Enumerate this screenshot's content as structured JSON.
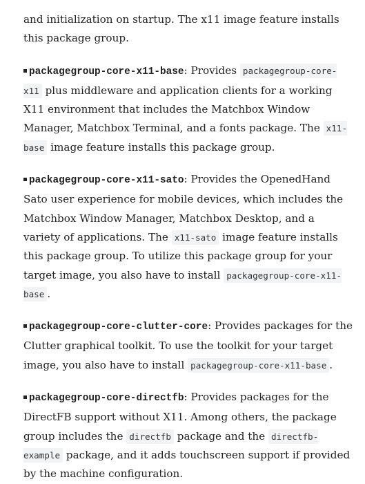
{
  "paragraphs": [
    {
      "segments": [
        {
          "kind": "text",
          "text": "and initialization on startup. The x11 image feature installs this package group."
        }
      ]
    },
    {
      "segments": [
        {
          "kind": "term",
          "text": "packagegroup-core-x11-base"
        },
        {
          "kind": "text",
          "text": ": Provides "
        },
        {
          "kind": "code",
          "text": "packagegroup-core-x11"
        },
        {
          "kind": "text",
          "text": " plus middleware and application clients for a working X11 environment that includes the Matchbox Window Manager, Matchbox Terminal, and a fonts package. The "
        },
        {
          "kind": "code",
          "text": "x11-base"
        },
        {
          "kind": "text",
          "text": " image feature installs this package group."
        }
      ]
    },
    {
      "segments": [
        {
          "kind": "term",
          "text": "packagegroup-core-x11-sato"
        },
        {
          "kind": "text",
          "text": ": Provides the OpenedHand Sato user experience for mobile devices, which includes the Matchbox Window Manager, Matchbox Desktop, and a variety of applications. The "
        },
        {
          "kind": "code",
          "text": "x11-sato"
        },
        {
          "kind": "text",
          "text": " image feature installs this package group. To utilize this package group for your target image, you also have to install "
        },
        {
          "kind": "code",
          "text": "packagegroup-core-x11-base"
        },
        {
          "kind": "text",
          "text": "."
        }
      ]
    },
    {
      "segments": [
        {
          "kind": "term",
          "text": "packagegroup-core-clutter-core"
        },
        {
          "kind": "text",
          "text": ": Provides packages for the Clutter graphical toolkit. To use the toolkit for your target image, you also have to install "
        },
        {
          "kind": "code",
          "text": "packagegroup-core-x11-base"
        },
        {
          "kind": "text",
          "text": "."
        }
      ]
    },
    {
      "segments": [
        {
          "kind": "term",
          "text": "packagegroup-core-directfb"
        },
        {
          "kind": "text",
          "text": ": Provides packages for the DirectFB support without X11. Among others, the package group includes the "
        },
        {
          "kind": "code",
          "text": "directfb"
        },
        {
          "kind": "text",
          "text": " package and the "
        },
        {
          "kind": "code",
          "text": "directfb-example"
        },
        {
          "kind": "text",
          "text": " package, and it adds touchscreen support if provided by the machine configuration."
        }
      ]
    }
  ]
}
